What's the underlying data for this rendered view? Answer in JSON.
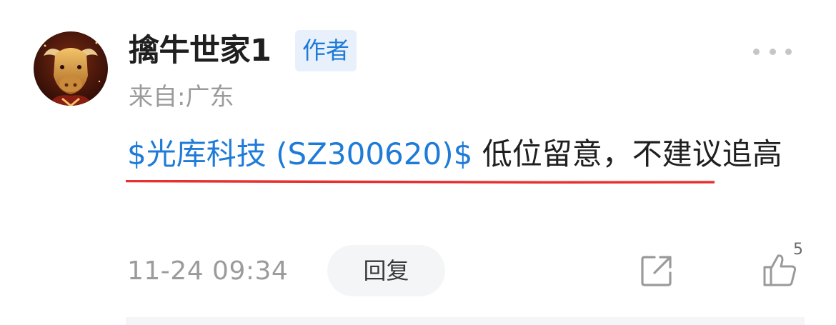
{
  "comment": {
    "username": "擒牛世家1",
    "author_badge": "作者",
    "location": "来自:广东",
    "content": {
      "stock_link": "$光库科技 (SZ300620)$",
      "text": " 低位留意，不建议追高"
    },
    "timestamp": "11-24 09:34",
    "reply_label": "回复",
    "like_count": "5"
  },
  "icons": {
    "more": "more-dots-icon",
    "share": "share-icon",
    "like": "thumbs-up-icon"
  },
  "colors": {
    "link": "#1e7bd8",
    "badge_bg": "#e8f1fb",
    "underline": "#e8312f",
    "muted_text": "#9b9b9b"
  }
}
